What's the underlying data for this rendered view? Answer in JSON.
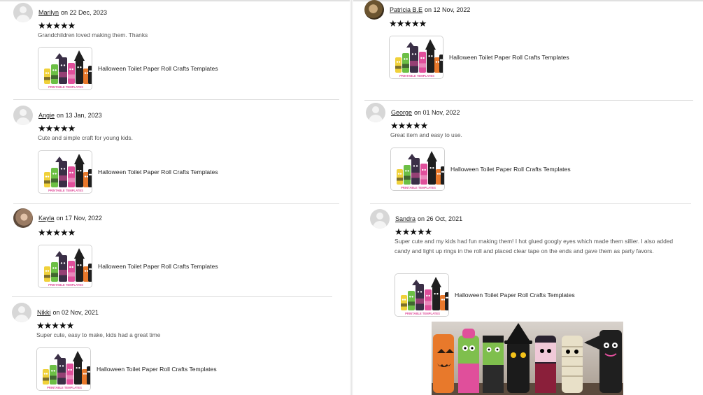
{
  "item_title": "Halloween Toilet Paper Roll Crafts Templates",
  "thumb_caption": "PRINTABLE TEMPLATES",
  "star_rating": 5,
  "stars_text": "★★★★★",
  "reviews": [
    {
      "name": "Marilyn",
      "date": "on 22 Dec, 2023",
      "text": "Grandchildren loved making them. Thanks",
      "avatar": "default-avatar-icon"
    },
    {
      "name": "Angie",
      "date": "on 13 Jan, 2023",
      "text": "Cute and simple craft for young kids.",
      "avatar": "default-avatar-icon"
    },
    {
      "name": "Kayla",
      "date": "on 17 Nov, 2022",
      "text": "",
      "avatar": "profile-photo"
    },
    {
      "name": "Nikki",
      "date": "on 02 Nov, 2021",
      "text": "Super cute, easy to make, kids had a great time",
      "avatar": "default-avatar-icon"
    },
    {
      "name": "Patricia B.E",
      "date": "on 12 Nov, 2022",
      "text": "",
      "avatar": "profile-photo"
    },
    {
      "name": "George",
      "date": "on 01 Nov, 2022",
      "text": "Great item and easy to use.",
      "avatar": "default-avatar-icon"
    },
    {
      "name": "Sandra",
      "date": "on 26 Oct, 2021",
      "text": "Super cute and my kids had fun making them! I hot glued googly eyes which made them sillier. I also added candy and light up rings in the roll and placed clear tape on the ends and gave them as party favors.",
      "avatar": "default-avatar-icon"
    }
  ],
  "colors": {
    "link": "#222222",
    "stars": "#111111",
    "divider": "#dcdcdc",
    "pumpkin": "#e8792b",
    "pink": "#e04f9b",
    "bat": "#2a2330"
  }
}
